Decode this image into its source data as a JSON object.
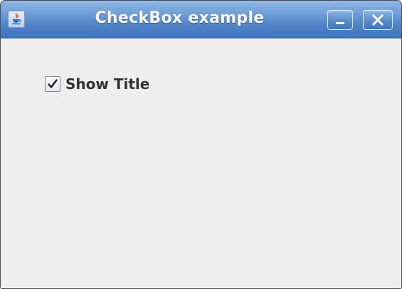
{
  "window": {
    "title": "CheckBox example",
    "icon": "java-cup-icon",
    "controls": {
      "minimize_icon": "minimize-icon",
      "close_icon": "close-icon"
    }
  },
  "content": {
    "checkbox": {
      "label": "Show Title",
      "checked": true
    }
  },
  "colors": {
    "titlebar": "#5487c9",
    "window_bg": "#eeeeee",
    "title_text": "#ffffff",
    "label_text": "#333333"
  }
}
